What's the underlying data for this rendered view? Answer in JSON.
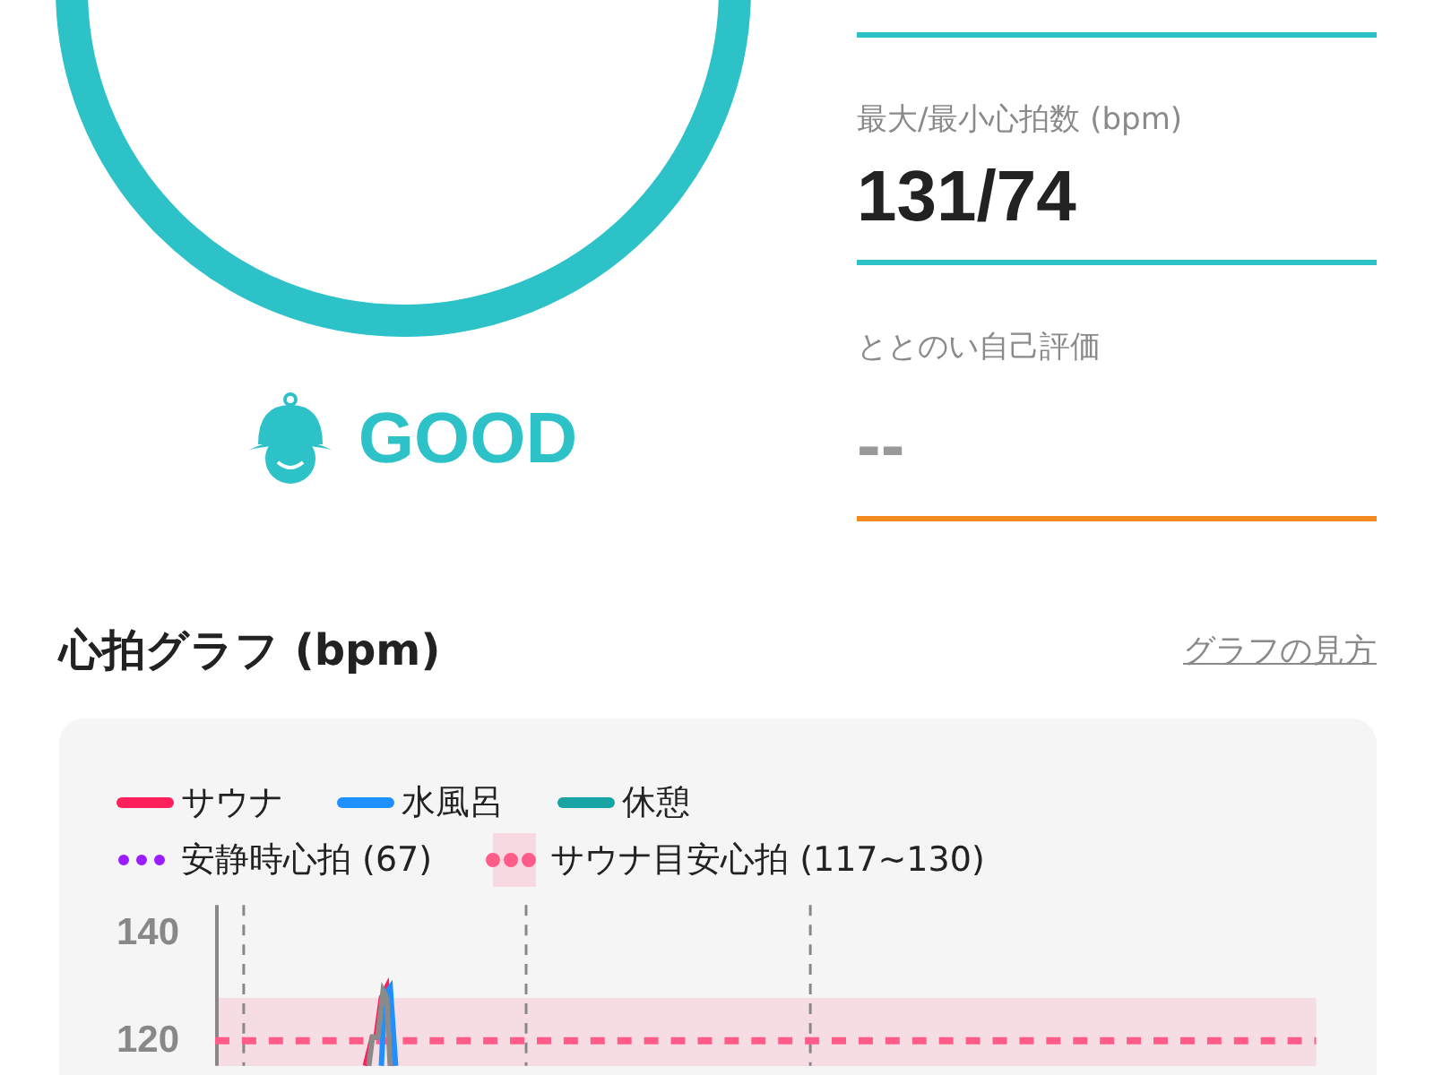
{
  "score": {
    "rating": "GOOD"
  },
  "stats": [
    {
      "label": "最大/最小心拍数 (bpm)",
      "value": "131/74",
      "kind": "filled"
    },
    {
      "label": "ととのい自己評価",
      "value": "--",
      "kind": "empty"
    }
  ],
  "heart_rate_graph": {
    "title": "心拍グラフ (bpm)",
    "help_link": "グラフの見方",
    "legend": [
      {
        "label": "サウナ",
        "color": "#ff1f5a",
        "kind": "solid"
      },
      {
        "label": "水風呂",
        "color": "#1e90ff",
        "kind": "solid"
      },
      {
        "label": "休憩",
        "color": "#1aa3a3",
        "kind": "solid"
      },
      {
        "label": "安静時心拍 (67)",
        "color": "#9b1cff",
        "kind": "dotted"
      },
      {
        "label": "サウナ目安心拍 (117~130)",
        "color": "#ff5c8a",
        "kind": "band"
      }
    ],
    "y_labels": [
      "140",
      "120"
    ]
  }
}
